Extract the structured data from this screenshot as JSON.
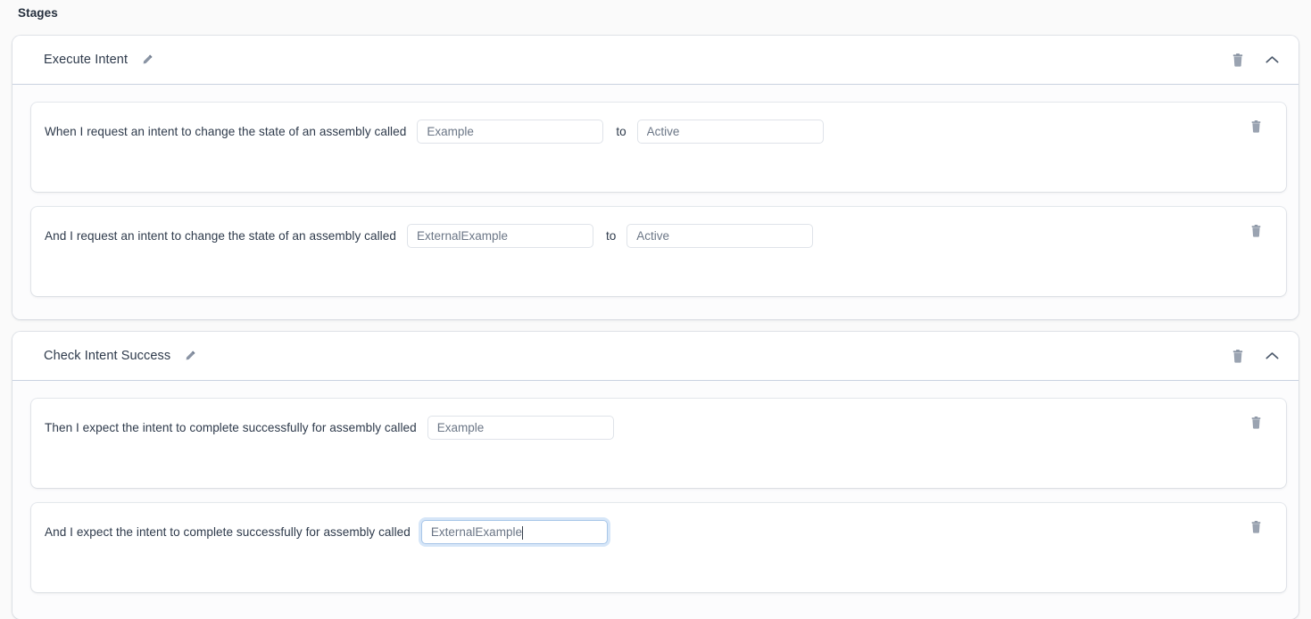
{
  "page": {
    "section_title": "Stages"
  },
  "icons": {
    "edit": "pencil-icon",
    "delete": "trash-icon",
    "collapse": "chevron-up-icon"
  },
  "colors": {
    "page_background": "#fafafa",
    "card_background": "#ffffff",
    "text": "#2e3a4b",
    "placeholder": "#6b7686",
    "divider": "#c9d2e0",
    "focus_ring": "#d6e6f8",
    "focus_border": "#a8c6e8"
  },
  "stages": [
    {
      "name": "Execute Intent",
      "expanded": true,
      "steps": [
        {
          "text": "When I request an intent to change the state of an assembly called",
          "fields": [
            {
              "value": "",
              "placeholder": "Example",
              "focused": false
            },
            {
              "label": "to",
              "value": "",
              "placeholder": "Active",
              "focused": false
            }
          ]
        },
        {
          "text": "And I request an intent to change the state of an assembly called",
          "fields": [
            {
              "value": "",
              "placeholder": "ExternalExample",
              "focused": false
            },
            {
              "label": "to",
              "value": "",
              "placeholder": "Active",
              "focused": false
            }
          ]
        }
      ]
    },
    {
      "name": "Check Intent Success",
      "expanded": true,
      "steps": [
        {
          "text": "Then I expect the intent to complete successfully for assembly called",
          "fields": [
            {
              "value": "",
              "placeholder": "Example",
              "focused": false
            }
          ]
        },
        {
          "text": "And I expect the intent to complete successfully for assembly called",
          "fields": [
            {
              "value": "",
              "placeholder": "ExternalExample",
              "focused": true
            }
          ]
        }
      ]
    }
  ]
}
